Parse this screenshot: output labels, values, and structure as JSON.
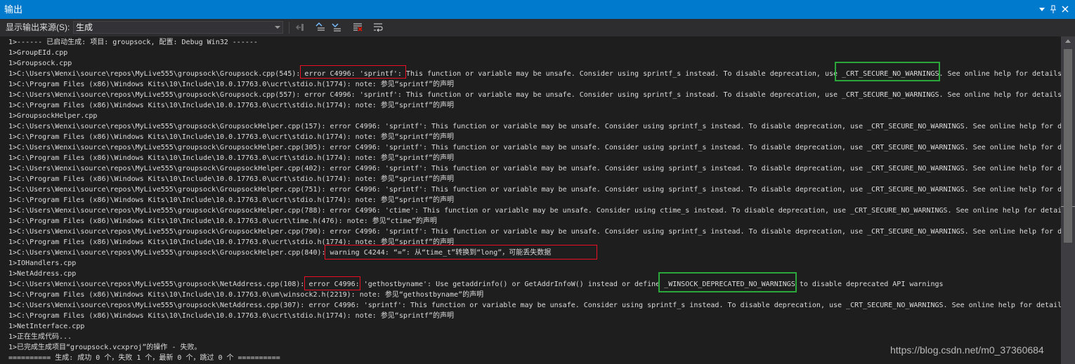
{
  "window": {
    "title": "输出"
  },
  "toolbar": {
    "source_label": "显示输出来源(S):",
    "source_value": "生成",
    "icons": [
      "find-message-icon",
      "prev-message-icon",
      "next-message-icon",
      "clear-all-icon",
      "word-wrap-icon"
    ]
  },
  "titlebar_icons": [
    "dropdown-icon",
    "pin-icon",
    "close-icon"
  ],
  "output_lines": [
    "1>------ 已启动生成: 项目: groupsock, 配置: Debug Win32 ------",
    "1>GroupEId.cpp",
    "1>Groupsock.cpp",
    "1>C:\\Users\\Wenxi\\source\\repos\\MyLive555\\groupsock\\Groupsock.cpp(545): error C4996: 'sprintf': This function or variable may be unsafe. Consider using sprintf_s instead. To disable deprecation, use _CRT_SECURE_NO_WARNINGS. See online help for details.",
    "1>C:\\Program Files (x86)\\Windows Kits\\10\\Include\\10.0.17763.0\\ucrt\\stdio.h(1774): note: 参见“sprintf”的声明",
    "1>C:\\Users\\Wenxi\\source\\repos\\MyLive555\\groupsock\\Groupsock.cpp(557): error C4996: 'sprintf': This function or variable may be unsafe. Consider using sprintf_s instead. To disable deprecation, use _CRT_SECURE_NO_WARNINGS. See online help for details.",
    "1>C:\\Program Files (x86)\\Windows Kits\\10\\Include\\10.0.17763.0\\ucrt\\stdio.h(1774): note: 参见“sprintf”的声明",
    "1>GroupsockHelper.cpp",
    "1>C:\\Users\\Wenxi\\source\\repos\\MyLive555\\groupsock\\GroupsockHelper.cpp(157): error C4996: 'sprintf': This function or variable may be unsafe. Consider using sprintf_s instead. To disable deprecation, use _CRT_SECURE_NO_WARNINGS. See online help for d",
    "1>C:\\Program Files (x86)\\Windows Kits\\10\\Include\\10.0.17763.0\\ucrt\\stdio.h(1774): note: 参见“sprintf”的声明",
    "1>C:\\Users\\Wenxi\\source\\repos\\MyLive555\\groupsock\\GroupsockHelper.cpp(305): error C4996: 'sprintf': This function or variable may be unsafe. Consider using sprintf_s instead. To disable deprecation, use _CRT_SECURE_NO_WARNINGS. See online help for d",
    "1>C:\\Program Files (x86)\\Windows Kits\\10\\Include\\10.0.17763.0\\ucrt\\stdio.h(1774): note: 参见“sprintf”的声明",
    "1>C:\\Users\\Wenxi\\source\\repos\\MyLive555\\groupsock\\GroupsockHelper.cpp(402): error C4996: 'sprintf': This function or variable may be unsafe. Consider using sprintf_s instead. To disable deprecation, use _CRT_SECURE_NO_WARNINGS. See online help for d",
    "1>C:\\Program Files (x86)\\Windows Kits\\10\\Include\\10.0.17763.0\\ucrt\\stdio.h(1774): note: 参见“sprintf”的声明",
    "1>C:\\Users\\Wenxi\\source\\repos\\MyLive555\\groupsock\\GroupsockHelper.cpp(751): error C4996: 'sprintf': This function or variable may be unsafe. Consider using sprintf_s instead. To disable deprecation, use _CRT_SECURE_NO_WARNINGS. See online help for d",
    "1>C:\\Program Files (x86)\\Windows Kits\\10\\Include\\10.0.17763.0\\ucrt\\stdio.h(1774): note: 参见“sprintf”的声明",
    "1>C:\\Users\\Wenxi\\source\\repos\\MyLive555\\groupsock\\GroupsockHelper.cpp(788): error C4996: 'ctime': This function or variable may be unsafe. Consider using ctime_s instead. To disable deprecation, use _CRT_SECURE_NO_WARNINGS. See online help for detail",
    "1>C:\\Program Files (x86)\\Windows Kits\\10\\Include\\10.0.17763.0\\ucrt\\time.h(476): note: 参见“ctime”的声明",
    "1>C:\\Users\\Wenxi\\source\\repos\\MyLive555\\groupsock\\GroupsockHelper.cpp(790): error C4996: 'sprintf': This function or variable may be unsafe. Consider using sprintf_s instead. To disable deprecation, use _CRT_SECURE_NO_WARNINGS. See online help for d",
    "1>C:\\Program Files (x86)\\Windows Kits\\10\\Include\\10.0.17763.0\\ucrt\\stdio.h(1774): note: 参见“sprintf”的声明",
    "1>C:\\Users\\Wenxi\\source\\repos\\MyLive555\\groupsock\\GroupsockHelper.cpp(840): warning C4244: “=”: 从“time_t”转换到“long”，可能丢失数据",
    "1>IOHandlers.cpp",
    "1>NetAddress.cpp",
    "1>C:\\Users\\Wenxi\\source\\repos\\MyLive555\\groupsock\\NetAddress.cpp(108): error C4996: 'gethostbyname': Use getaddrinfo() or GetAddrInfoW() instead or define _WINSOCK_DEPRECATED_NO_WARNINGS to disable deprecated API warnings",
    "1>C:\\Program Files (x86)\\Windows Kits\\10\\Include\\10.0.17763.0\\um\\winsock2.h(2219): note: 参见“gethostbyname”的声明",
    "1>C:\\Users\\Wenxi\\source\\repos\\MyLive555\\groupsock\\NetAddress.cpp(307): error C4996: 'sprintf': This function or variable may be unsafe. Consider using sprintf_s instead. To disable deprecation, use _CRT_SECURE_NO_WARNINGS. See online help for detail",
    "1>C:\\Program Files (x86)\\Windows Kits\\10\\Include\\10.0.17763.0\\ucrt\\stdio.h(1774): note: 参见“sprintf”的声明",
    "1>NetInterface.cpp",
    "1>正在生成代码...",
    "1>已完成生成项目“groupsock.vcxproj”的操作 - 失败。",
    "========== 生成: 成功 0 个，失败 1 个，最新 0 个，跳过 0 个 =========="
  ],
  "watermark": "https://blog.csdn.net/m0_37360684",
  "colors": {
    "title_bar": "#007acc",
    "output_bg": "#1e1e1e",
    "text": "#dcdcdc",
    "highlight_red": "#e81123",
    "highlight_green": "#2aa63a"
  }
}
